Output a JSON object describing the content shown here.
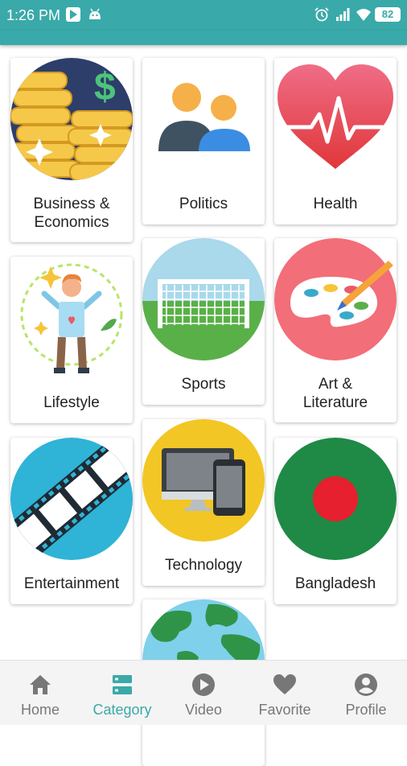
{
  "status_bar": {
    "time": "1:26 PM",
    "battery": "82"
  },
  "categories": [
    {
      "name": "Business &\nEconomics",
      "icon": "business-coins-icon"
    },
    {
      "name": "Politics",
      "icon": "people-icon"
    },
    {
      "name": "Health",
      "icon": "heart-pulse-icon"
    },
    {
      "name": "Lifestyle",
      "icon": "lifestyle-person-icon"
    },
    {
      "name": "Sports",
      "icon": "soccer-goal-icon"
    },
    {
      "name": "Art &\nLiterature",
      "icon": "paint-palette-icon"
    },
    {
      "name": "Entertainment",
      "icon": "film-strip-icon"
    },
    {
      "name": "Technology",
      "icon": "computer-phone-icon"
    },
    {
      "name": "Bangladesh",
      "icon": "bangladesh-flag-icon"
    },
    {
      "name": "",
      "icon": "globe-icon"
    }
  ],
  "bottom_nav": [
    {
      "label": "Home",
      "icon": "home-icon"
    },
    {
      "label": "Category",
      "icon": "category-icon",
      "active": true
    },
    {
      "label": "Video",
      "icon": "play-circle-icon"
    },
    {
      "label": "Favorite",
      "icon": "heart-icon"
    },
    {
      "label": "Profile",
      "icon": "profile-icon"
    }
  ],
  "colors": {
    "accent": "#3aa9a9",
    "inactive": "#777777"
  }
}
